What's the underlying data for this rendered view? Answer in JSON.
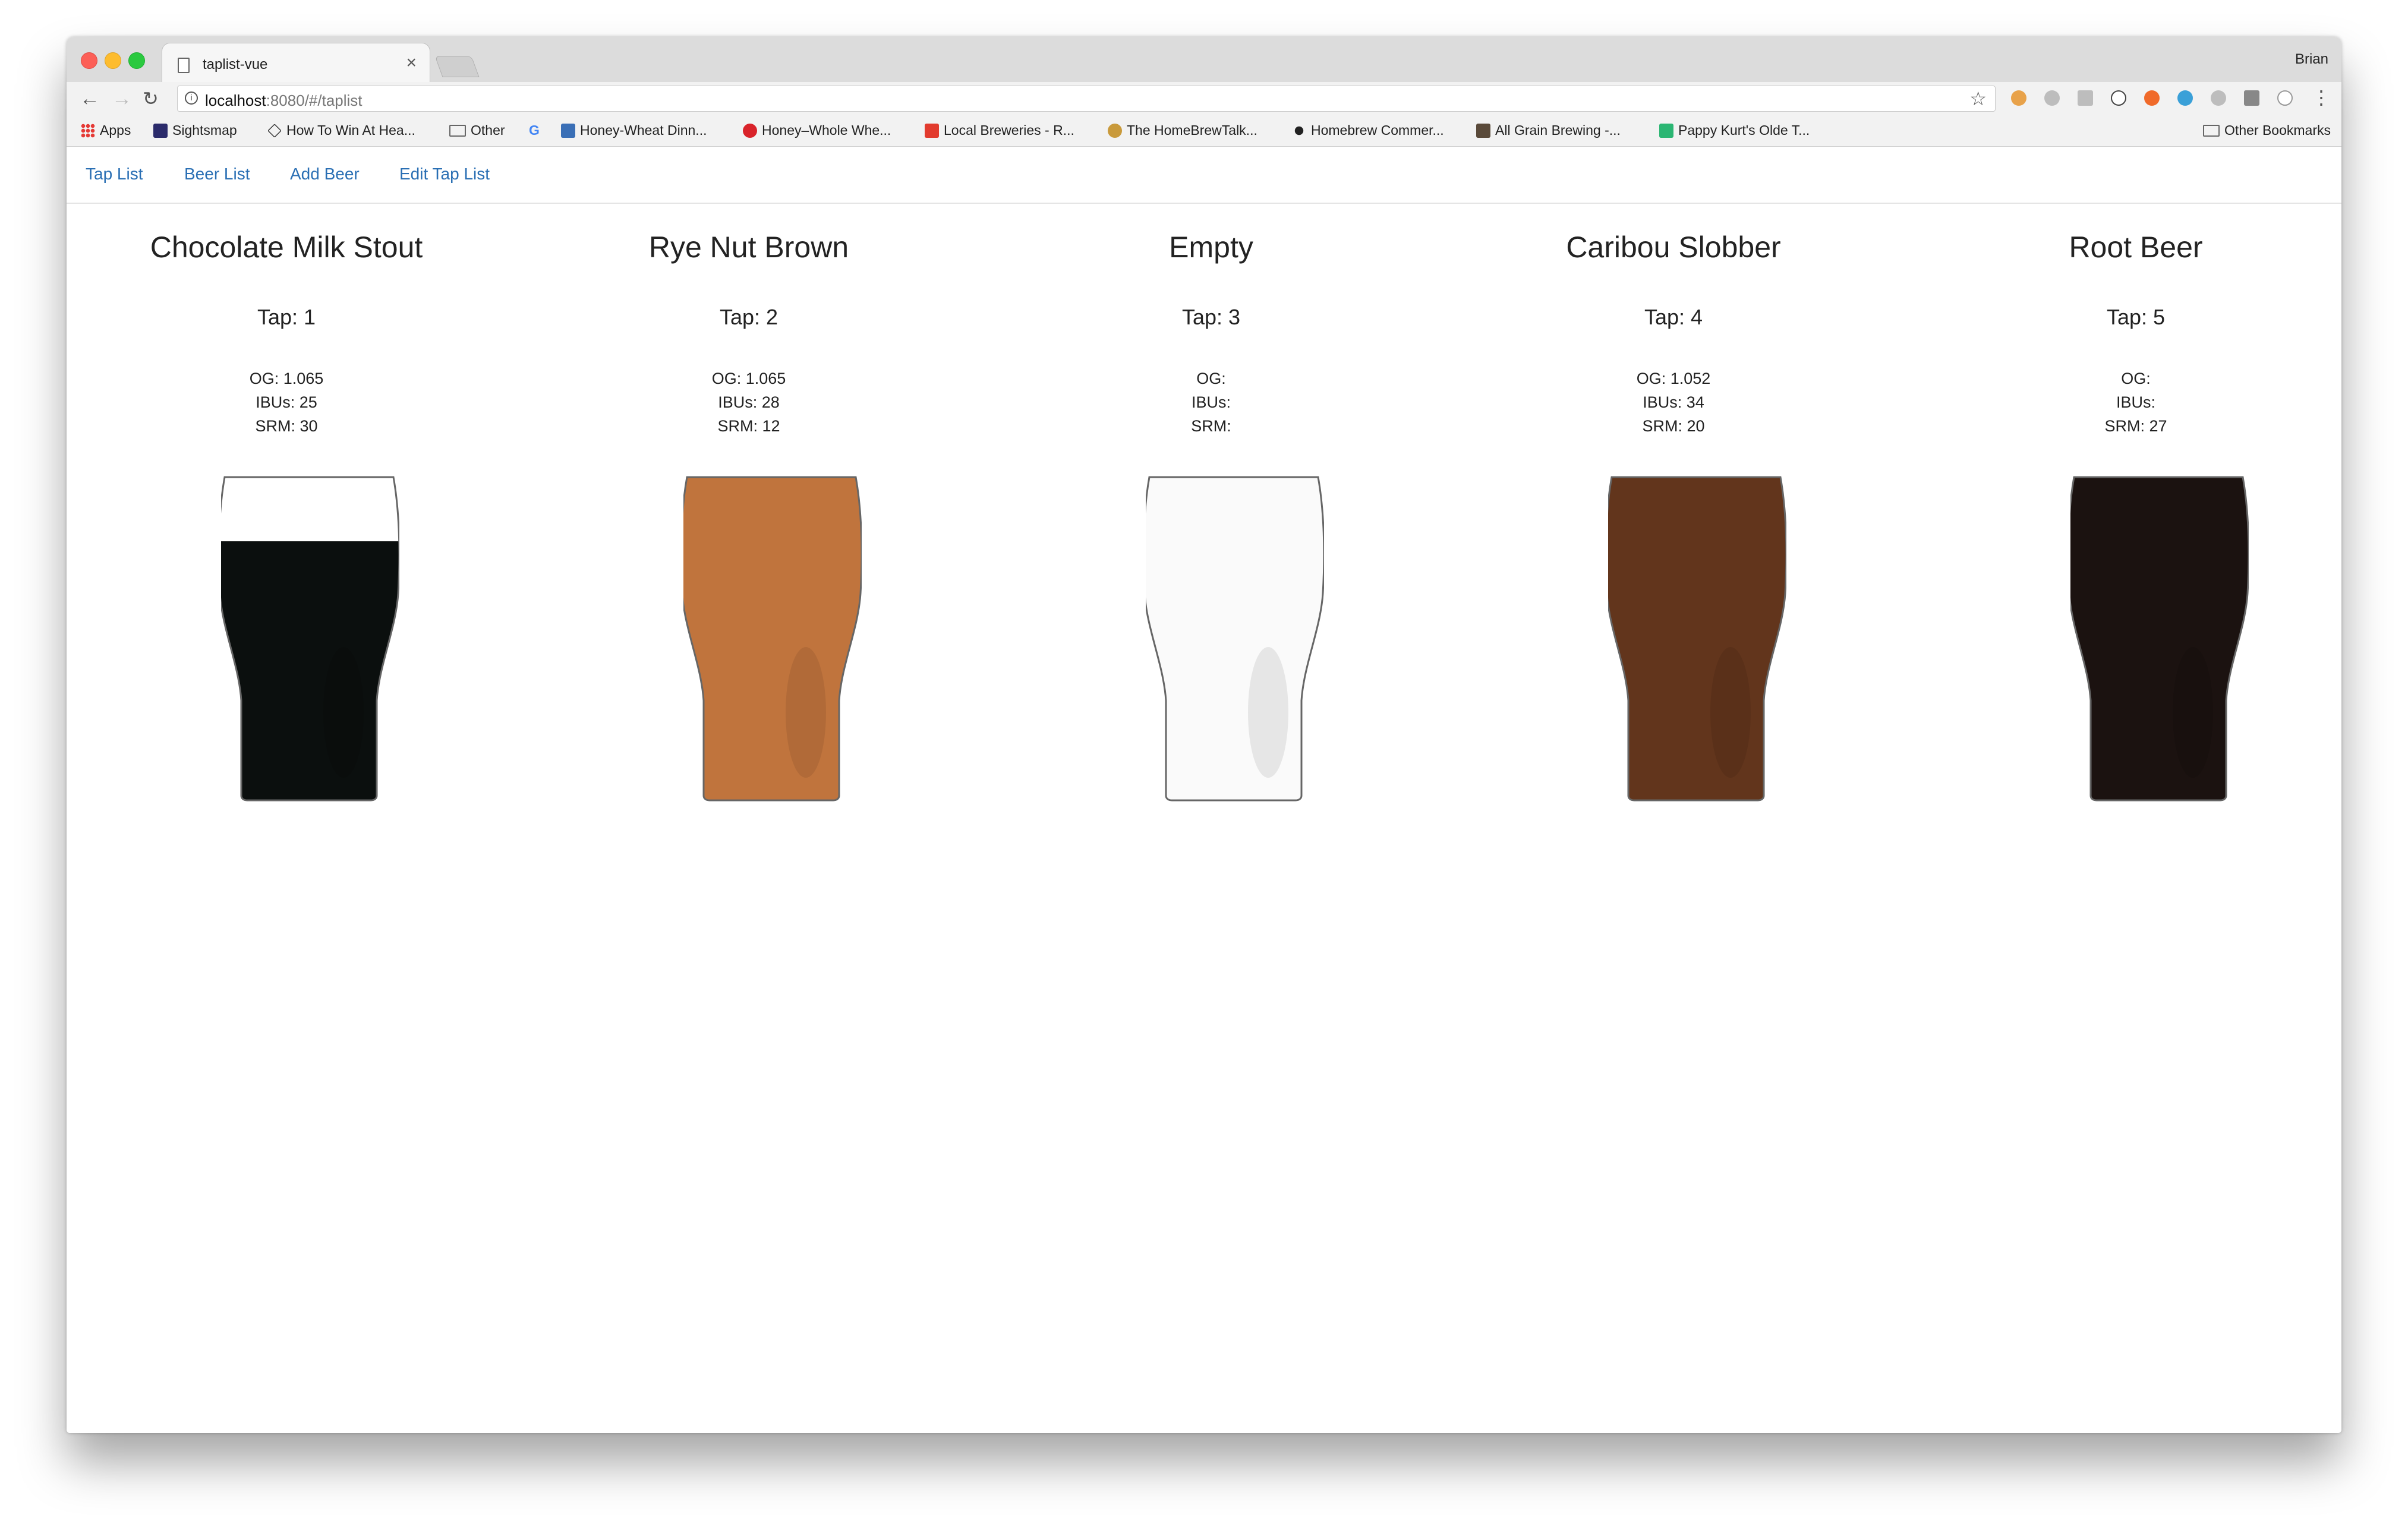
{
  "browser": {
    "tab_title": "taplist-vue",
    "tab_close": "×",
    "profile_name": "Brian",
    "url_host": "localhost",
    "url_rest": ":8080/#/taplist",
    "bookmarks": [
      {
        "label": "Apps"
      },
      {
        "label": "Sightsmap"
      },
      {
        "label": "How To Win At Hea..."
      },
      {
        "label": "Other"
      },
      {
        "label": "Honey-Wheat Dinn..."
      },
      {
        "label": "Honey–Whole Whe..."
      },
      {
        "label": "Local Breweries - R..."
      },
      {
        "label": "The HomeBrewTalk..."
      },
      {
        "label": "Homebrew Commer..."
      },
      {
        "label": "All Grain Brewing -..."
      },
      {
        "label": "Pappy Kurt's Olde T..."
      }
    ],
    "other_bookmarks": "Other Bookmarks"
  },
  "nav": {
    "tap_list": "Tap List",
    "beer_list": "Beer List",
    "add_beer": "Add Beer",
    "edit_tap_list": "Edit Tap List"
  },
  "taps": [
    {
      "name": "Chocolate Milk Stout",
      "tap": "Tap: 1",
      "og": "OG: 1.065",
      "ibus": "IBUs: 25",
      "srm": "SRM: 30",
      "color": "#0b0f0e",
      "fill_level": 0.8
    },
    {
      "name": "Rye Nut Brown",
      "tap": "Tap: 2",
      "og": "OG: 1.065",
      "ibus": "IBUs: 28",
      "srm": "SRM: 12",
      "color": "#c0743d",
      "fill_level": 1.0
    },
    {
      "name": "Empty",
      "tap": "Tap: 3",
      "og": "OG:",
      "ibus": "IBUs:",
      "srm": "SRM:",
      "color": "#fafafa",
      "fill_level": 1.0
    },
    {
      "name": "Caribou Slobber",
      "tap": "Tap: 4",
      "og": "OG: 1.052",
      "ibus": "IBUs: 34",
      "srm": "SRM: 20",
      "color": "#62351c",
      "fill_level": 1.0
    },
    {
      "name": "Root Beer",
      "tap": "Tap: 5",
      "og": "OG:",
      "ibus": "IBUs:",
      "srm": "SRM: 27",
      "color": "#1b1210",
      "fill_level": 1.0
    }
  ]
}
